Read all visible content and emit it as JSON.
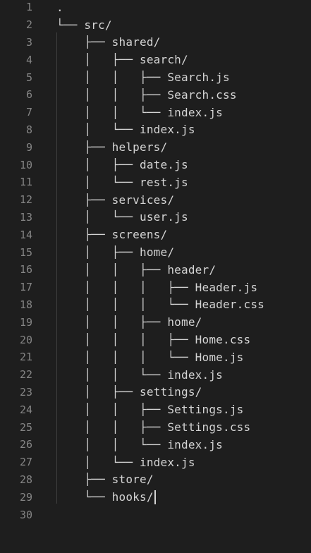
{
  "editor": {
    "lines": [
      {
        "n": "1",
        "text": "."
      },
      {
        "n": "2",
        "text": "└── src/"
      },
      {
        "n": "3",
        "text": "    ├── shared/"
      },
      {
        "n": "4",
        "text": "    │   ├── search/"
      },
      {
        "n": "5",
        "text": "    │   │   ├── Search.js"
      },
      {
        "n": "6",
        "text": "    │   │   ├── Search.css"
      },
      {
        "n": "7",
        "text": "    │   │   └── index.js"
      },
      {
        "n": "8",
        "text": "    │   └── index.js"
      },
      {
        "n": "9",
        "text": "    ├── helpers/"
      },
      {
        "n": "10",
        "text": "    │   ├── date.js"
      },
      {
        "n": "11",
        "text": "    │   └── rest.js"
      },
      {
        "n": "12",
        "text": "    ├── services/"
      },
      {
        "n": "13",
        "text": "    │   └── user.js"
      },
      {
        "n": "14",
        "text": "    ├── screens/"
      },
      {
        "n": "15",
        "text": "    │   ├── home/"
      },
      {
        "n": "16",
        "text": "    │   │   ├── header/"
      },
      {
        "n": "17",
        "text": "    │   │   │   ├── Header.js"
      },
      {
        "n": "18",
        "text": "    │   │   │   └── Header.css"
      },
      {
        "n": "19",
        "text": "    │   │   ├── home/"
      },
      {
        "n": "20",
        "text": "    │   │   │   ├── Home.css"
      },
      {
        "n": "21",
        "text": "    │   │   │   └── Home.js"
      },
      {
        "n": "22",
        "text": "    │   │   └── index.js"
      },
      {
        "n": "23",
        "text": "    │   ├── settings/"
      },
      {
        "n": "24",
        "text": "    │   │   ├── Settings.js"
      },
      {
        "n": "25",
        "text": "    │   │   ├── Settings.css"
      },
      {
        "n": "26",
        "text": "    │   │   └── index.js"
      },
      {
        "n": "27",
        "text": "    │   └── index.js"
      },
      {
        "n": "28",
        "text": "    ├── store/"
      },
      {
        "n": "29",
        "text": "    └── hooks/"
      },
      {
        "n": "30",
        "text": ""
      }
    ],
    "cursor_line": "29"
  }
}
